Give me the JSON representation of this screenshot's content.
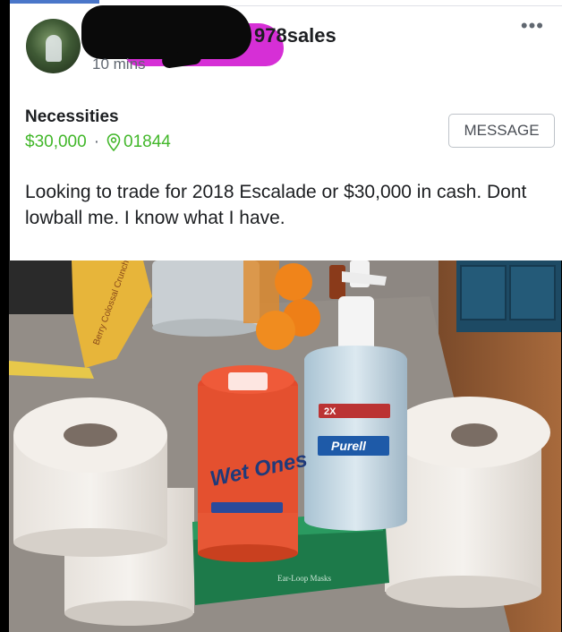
{
  "post": {
    "page_name": "978sales",
    "time": "10 mins",
    "more_label": "•••",
    "title": "Necessities",
    "price": "$30,000",
    "separator": "·",
    "location": "01844",
    "message_button": "MESSAGE",
    "description": "Looking to trade for 2018 Escalade or $30,000 in cash. Dont lowball me. I know what I have."
  },
  "photo": {
    "wipes_brand": "Wet Ones",
    "sanitizer_brand": "Purell",
    "sanitizer_badge": "2X",
    "mask_box_label": "Ear-Loop Masks",
    "snack_bag_label": "Berry Colossal Crunch"
  },
  "colors": {
    "price_green": "#42b72a",
    "accent_blue": "#4a76c9"
  },
  "icons": [
    "location-pin-icon",
    "more-options-icon"
  ]
}
